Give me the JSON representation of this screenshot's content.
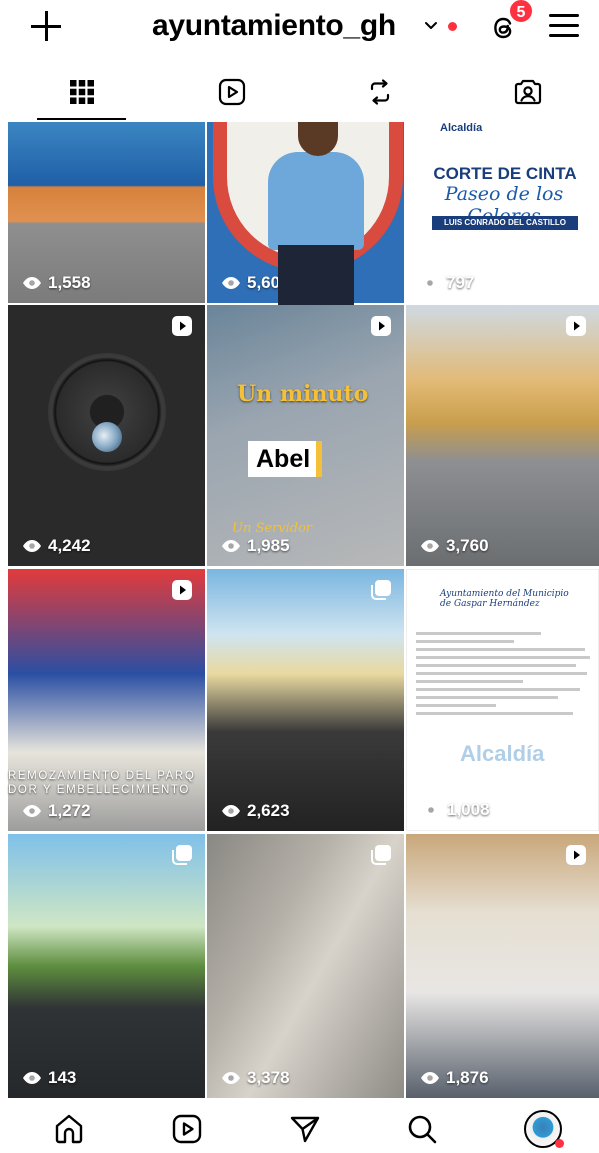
{
  "header": {
    "username": "ayuntamiento_gh",
    "threads_badge_count": "5",
    "icons": [
      "plus-icon",
      "chevron-down-icon",
      "threads-icon",
      "menu-icon"
    ],
    "notification_dot_color": "#ff3040"
  },
  "tabs": [
    {
      "name": "grid",
      "icon": "grid-icon",
      "active": true
    },
    {
      "name": "reels",
      "icon": "reels-icon",
      "active": false
    },
    {
      "name": "reposts",
      "icon": "repost-icon",
      "active": false
    },
    {
      "name": "tagged",
      "icon": "tagged-icon",
      "active": false
    }
  ],
  "posts": [
    {
      "views": "1,558",
      "type": "image"
    },
    {
      "views": "5,609",
      "type": "image"
    },
    {
      "views": "797",
      "type": "image",
      "card": {
        "top": "Alcaldía",
        "title": "CORTE DE CINTA",
        "subtitle": "Paseo de los Colores",
        "school": "LUIS CONRADO DEL CASTILLO"
      }
    },
    {
      "views": "4,242",
      "type": "reel"
    },
    {
      "views": "1,985",
      "type": "reel",
      "overlay": {
        "headline": "Un minuto",
        "name": "Abel",
        "tagline": "Un Servidor"
      }
    },
    {
      "views": "3,760",
      "type": "reel"
    },
    {
      "views": "1,272",
      "type": "reel",
      "caption": "REMOZAMIENTO DEL PARQ DOR Y EMBELLECIMIENTO"
    },
    {
      "views": "2,623",
      "type": "carousel"
    },
    {
      "views": "1,008",
      "type": "image",
      "doc": {
        "heading": "Ayuntamiento del Municipio de Gaspar Hernández",
        "watermark": "Alcaldía"
      }
    },
    {
      "views": "143",
      "type": "carousel"
    },
    {
      "views": "3,378",
      "type": "carousel"
    },
    {
      "views": "1,876",
      "type": "reel"
    }
  ],
  "bottom_nav": [
    {
      "name": "home",
      "icon": "home-icon"
    },
    {
      "name": "reels",
      "icon": "reels-icon"
    },
    {
      "name": "messages",
      "icon": "send-icon"
    },
    {
      "name": "search",
      "icon": "search-icon"
    },
    {
      "name": "profile",
      "icon": "profile-avatar"
    }
  ]
}
